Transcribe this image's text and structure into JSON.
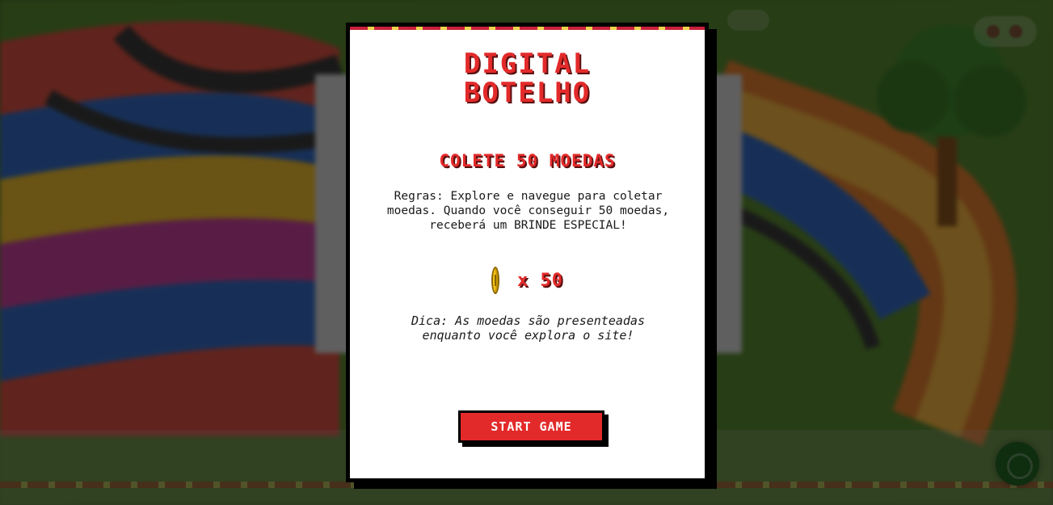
{
  "modal": {
    "title_line1": "DIGITAL",
    "title_line2": "BOTELHO",
    "subtitle": "COLETE 50 MOEDAS",
    "rules": "Regras: Explore e navegue para coletar moedas. Quando você conseguir 50 moedas, receberá um BRINDE ESPECIAL!",
    "coin_icon": "coin-icon",
    "coin_count": "x 50",
    "tip": "Dica: As moedas são presenteadas enquanto você explora o site!",
    "start_button": "START GAME"
  },
  "colors": {
    "accent_red": "#e32a2a",
    "title_shadow": "#5a0f0f",
    "coin_gold": "#f5c518",
    "modal_bg": "#ffffff",
    "modal_border": "#000000"
  }
}
